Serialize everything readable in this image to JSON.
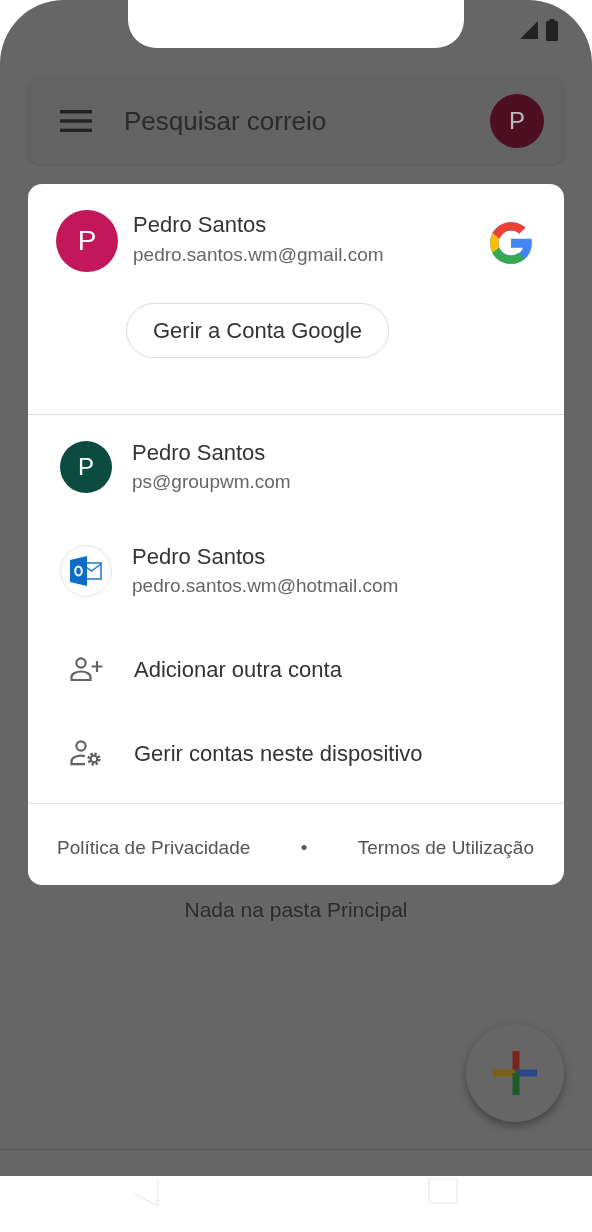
{
  "search": {
    "placeholder": "Pesquisar correio",
    "avatar_letter": "P"
  },
  "empty_message": "Nada na pasta Principal",
  "account_menu": {
    "current": {
      "avatar_letter": "P",
      "color": "#c2185b",
      "name": "Pedro Santos",
      "email": "pedro.santos.wm@gmail.com"
    },
    "manage_button": "Gerir a Conta Google",
    "accounts": [
      {
        "kind": "letter",
        "avatar_letter": "P",
        "color": "#0b4b40",
        "name": "Pedro Santos",
        "email": "ps@groupwm.com"
      },
      {
        "kind": "outlook",
        "name": "Pedro Santos",
        "email": "pedro.santos.wm@hotmail.com"
      }
    ],
    "actions": [
      {
        "kind": "add",
        "label": "Adicionar outra conta"
      },
      {
        "kind": "manage",
        "label": "Gerir contas neste dispositivo"
      }
    ],
    "footer": {
      "links": [
        "Política de Privacidade",
        "Termos de Utilização"
      ],
      "separator": "•"
    }
  }
}
